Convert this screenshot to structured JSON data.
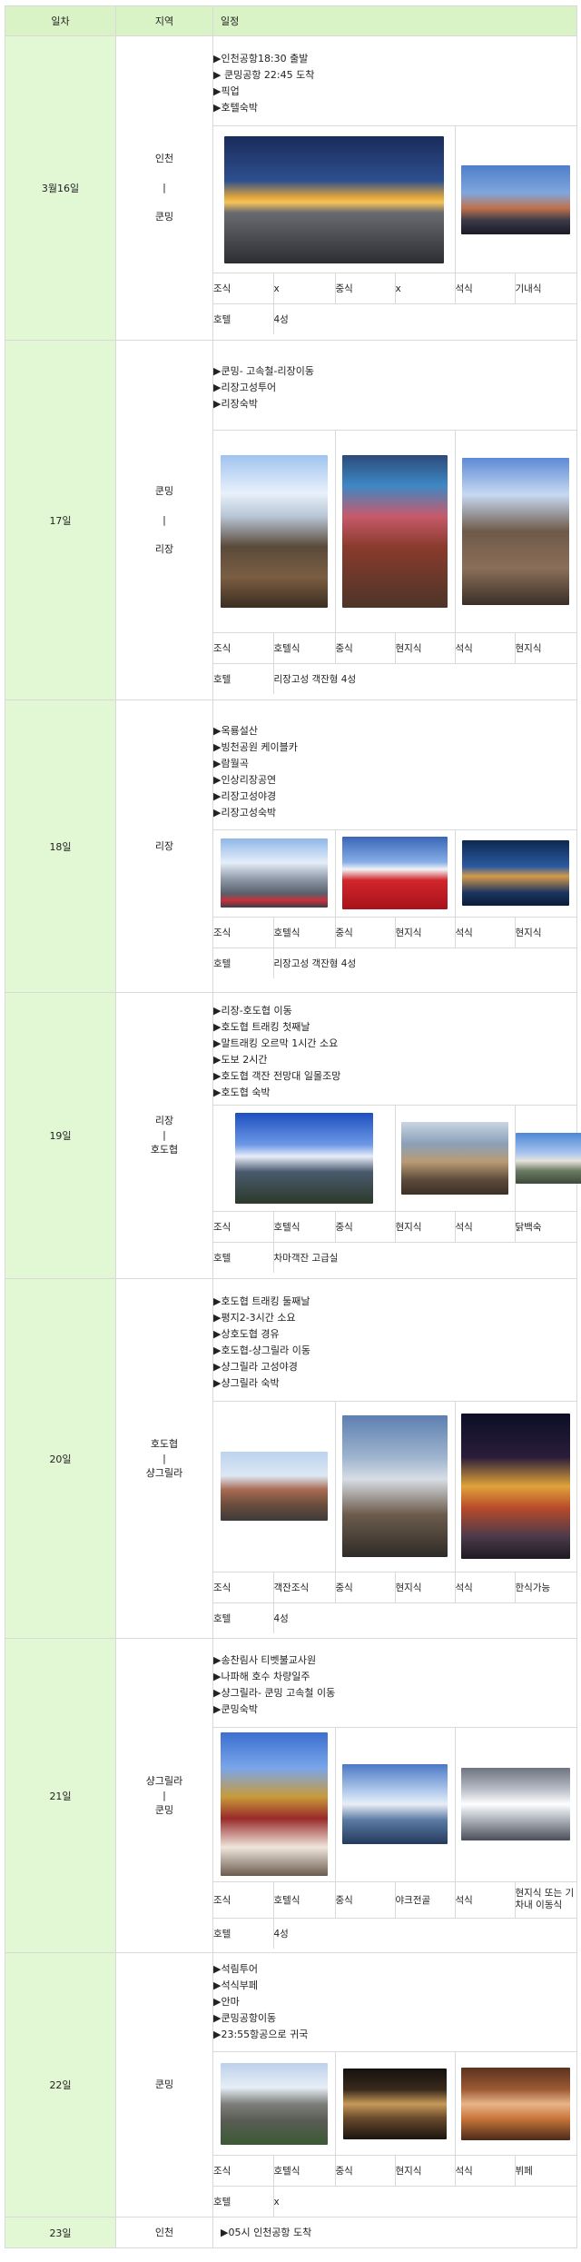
{
  "header": {
    "col_day": "일차",
    "col_region": "지역",
    "col_schedule": "일정"
  },
  "meal_labels": {
    "breakfast": "조식",
    "lunch": "중식",
    "dinner": "석식",
    "hotel": "호텔"
  },
  "days": [
    {
      "day": "3월16일",
      "region": [
        "인천",
        "|",
        "쿤밍"
      ],
      "items": [
        "▶인천공항18:30 출발",
        "▶ 쿤밍공항 22:45 도착",
        "▶픽업",
        "▶호텔숙박"
      ],
      "photos": [
        "airport-photo",
        "city-photo"
      ],
      "breakfast": "x",
      "lunch": "x",
      "dinner": "기내식",
      "hotel": "4성"
    },
    {
      "day": "17일",
      "region": [
        "쿤밍",
        "|",
        "리장"
      ],
      "items": [
        "▶쿤밍- 고속철-리장이동",
        "▶리장고성투어",
        "▶리장숙박"
      ],
      "photos": [
        "snow-mountain-waterwheel-photo",
        "umbrella-street-photo",
        "old-town-photo"
      ],
      "breakfast": "호텔식",
      "lunch": "현지식",
      "dinner": "현지식",
      "hotel": "리장고성 객잔형 4성"
    },
    {
      "day": "18일",
      "region": [
        "리장"
      ],
      "items": [
        "▶옥룡설산",
        "▶빙천공원 케이블카",
        "▶람월곡",
        "▶인상리장공연",
        "▶리장고성야경",
        "▶리장고성숙박"
      ],
      "photos": [
        "glacier-photo",
        "red-field-photo",
        "night-old-town-photo"
      ],
      "breakfast": "호텔식",
      "lunch": "현지식",
      "dinner": "현지식",
      "hotel": "리장고성 객잔형 4성"
    },
    {
      "day": "19일",
      "region": [
        "리장",
        "|",
        "호도협"
      ],
      "items": [
        "▶리장-호도협 이동",
        "▶호도협 트래킹 첫째날",
        "▶말트래킹 오르막 1시간 소요",
        "▶도보 2시간",
        "▶호도협 객잔 전망대 일몰조망",
        "▶호도협 숙박"
      ],
      "photos": [
        "snow-peaks-photo",
        "gorge-horse-photo",
        "valley-photo"
      ],
      "breakfast": "호텔식",
      "lunch": "현지식",
      "dinner": "닭백숙",
      "hotel": "차마객잔 고급실"
    },
    {
      "day": "20일",
      "region": [
        "호도협",
        "|",
        "샹그릴라"
      ],
      "items": [
        "▶호도협 트래킹 둘째날",
        "▶평지2-3시간 소요",
        "▶상호도협 경유",
        "▶호도협-샹그릴라 이동",
        "▶샹그릴라 고성야경",
        "▶샹그릴라 숙박"
      ],
      "photos": [
        "ridge-photo",
        "waterfall-photo",
        "lantern-night-photo"
      ],
      "breakfast": "객잔조식",
      "lunch": "현지식",
      "dinner": "한식가능",
      "hotel": "4성"
    },
    {
      "day": "21일",
      "region": [
        "샹그릴라",
        "|",
        "쿤밍"
      ],
      "items": [
        "▶송찬림사 티벳불교사원",
        "▶나파해 호수 차량일주",
        "▶샹그릴라- 쿤밍 고속철 이동",
        "▶쿤밍숙박"
      ],
      "photos": [
        "monastery-photo",
        "lake-photo",
        "train-photo"
      ],
      "breakfast": "호텔식",
      "lunch": "야크전골",
      "dinner": "현지식 또는 기차내 이동식",
      "hotel": "4성"
    },
    {
      "day": "22일",
      "region": [
        "쿤밍"
      ],
      "items": [
        "▶석림투어",
        "▶석식부페",
        "▶안마",
        "▶쿤밍공항이동",
        "▶23:55항공으로 귀국"
      ],
      "photos": [
        "stone-forest-photo",
        "theater-photo",
        "massage-photo"
      ],
      "breakfast": "호텔식",
      "lunch": "현지식",
      "dinner": "뷔페",
      "hotel": "x"
    },
    {
      "day": "23일",
      "region": [
        "인천"
      ],
      "items": [
        "▶05시 인천공항 도착"
      ]
    }
  ]
}
